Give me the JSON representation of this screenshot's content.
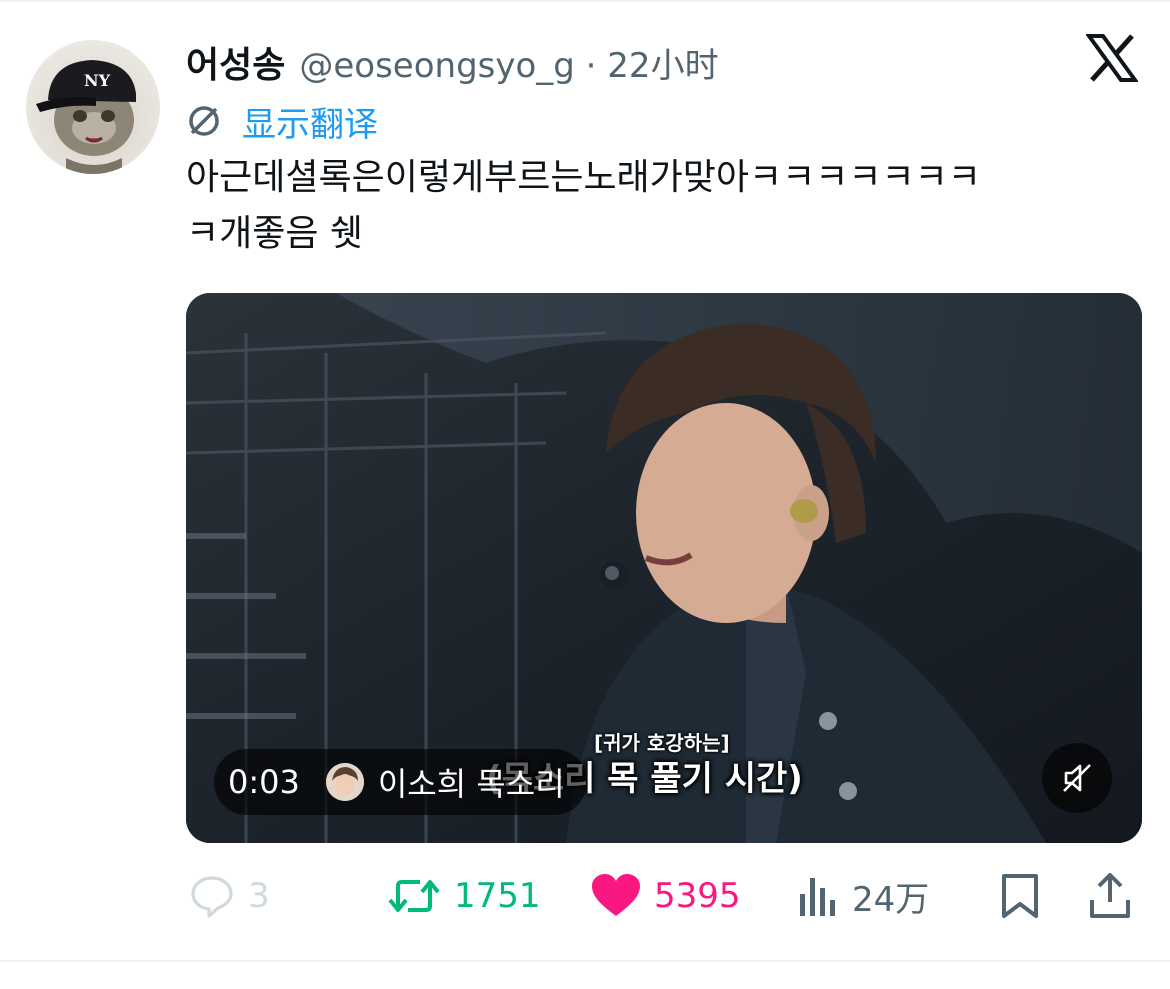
{
  "tweet": {
    "author_name": "어성송",
    "author_handle_line": "@eoseongsyo_g · 22小时",
    "translate_label": "显示翻译",
    "text_line1": "아근데셜록은이렇게부르는노래가맞아ㅋㅋㅋㅋㅋㅋㅋ",
    "text_line2": "ㅋ개좋음 쉣"
  },
  "media": {
    "time": "0:03",
    "uploader": "이소희 목소리",
    "subtitle_top": "[귀가 호강하는]",
    "subtitle_main": "(목소리 목 풀기 시간)"
  },
  "actions": {
    "reply_count": "3",
    "retweet_count": "1751",
    "like_count": "5395",
    "views_count": "24万"
  },
  "colors": {
    "accent_blue": "#1d9bf0",
    "retweet_green": "#00ba7c",
    "like_pink": "#f91880",
    "secondary_gray": "#536471",
    "disabled_gray": "#cfd9de"
  },
  "icons": [
    "x-logo-icon",
    "translate-icon",
    "mute-icon",
    "reply-icon",
    "retweet-icon",
    "like-icon",
    "views-icon",
    "bookmark-icon",
    "share-icon"
  ]
}
